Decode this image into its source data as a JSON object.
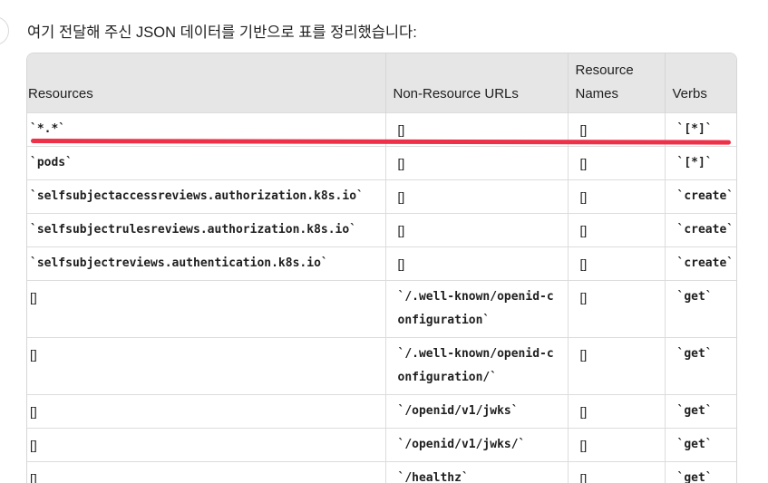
{
  "intro_text": "여기 전달해 주신 JSON 데이터를 기반으로 표를 정리했습니다:",
  "table": {
    "headers": {
      "resources": "Resources",
      "non_resource_urls": "Non-Resource URLs",
      "resource_names": "Resource Names",
      "verbs": "Verbs"
    },
    "rows": [
      {
        "resources": "`*.*`",
        "non_resource_urls": "[]",
        "resource_names": "[]",
        "verbs": "`[*]`"
      },
      {
        "resources": "`pods`",
        "non_resource_urls": "[]",
        "resource_names": "[]",
        "verbs": "`[*]`"
      },
      {
        "resources": "`selfsubjectaccessreviews.authorization.k8s.io`",
        "non_resource_urls": "[]",
        "resource_names": "[]",
        "verbs": "`create`"
      },
      {
        "resources": "`selfsubjectrulesreviews.authorization.k8s.io`",
        "non_resource_urls": "[]",
        "resource_names": "[]",
        "verbs": "`create`"
      },
      {
        "resources": "`selfsubjectreviews.authentication.k8s.io`",
        "non_resource_urls": "[]",
        "resource_names": "[]",
        "verbs": "`create`"
      },
      {
        "resources": "[]",
        "non_resource_urls": "`/.well-known/openid-configuration`",
        "resource_names": "[]",
        "verbs": "`get`"
      },
      {
        "resources": "[]",
        "non_resource_urls": "`/.well-known/openid-configuration/`",
        "resource_names": "[]",
        "verbs": "`get`"
      },
      {
        "resources": "[]",
        "non_resource_urls": "`/openid/v1/jwks`",
        "resource_names": "[]",
        "verbs": "`get`"
      },
      {
        "resources": "[]",
        "non_resource_urls": "`/openid/v1/jwks/`",
        "resource_names": "[]",
        "verbs": "`get`"
      },
      {
        "resources": "[]",
        "non_resource_urls": "`/healthz`",
        "resource_names": "[]",
        "verbs": "`get`"
      }
    ]
  },
  "colors": {
    "highlight_mark": "#ee3048",
    "header_bg": "#e6e6e6",
    "border": "#d6d6d6"
  }
}
